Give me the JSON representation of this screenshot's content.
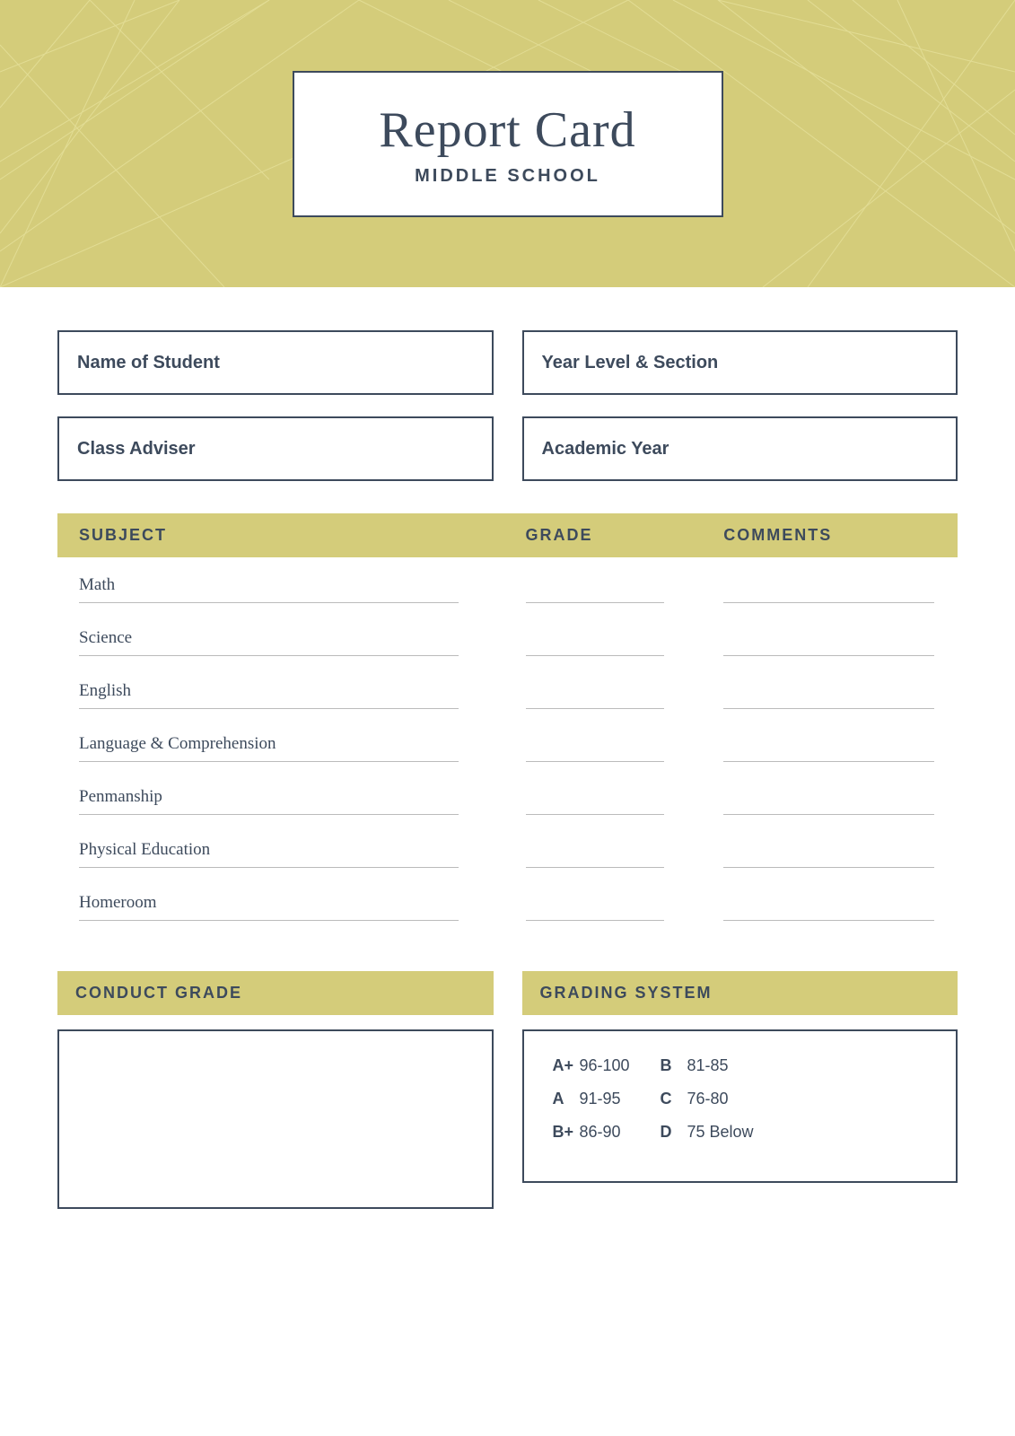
{
  "header": {
    "title": "Report Card",
    "subtitle": "MIDDLE SCHOOL"
  },
  "info": {
    "name_label": "Name of Student",
    "year_label": "Year Level & Section",
    "adviser_label": "Class Adviser",
    "academic_label": "Academic Year"
  },
  "table": {
    "col_subject": "SUBJECT",
    "col_grade": "GRADE",
    "col_comments": "COMMENTS",
    "subjects": [
      {
        "name": "Math"
      },
      {
        "name": "Science"
      },
      {
        "name": "English"
      },
      {
        "name": "Language & Comprehension"
      },
      {
        "name": "Penmanship"
      },
      {
        "name": "Physical Education"
      },
      {
        "name": "Homeroom"
      }
    ]
  },
  "conduct": {
    "header": "CONDUCT GRADE"
  },
  "grading": {
    "header": "GRADING SYSTEM",
    "rows": [
      {
        "letter": "A+",
        "range": "96-100",
        "letter2": "B",
        "range2": "81-85"
      },
      {
        "letter": "A",
        "range": "91-95",
        "letter2": "C",
        "range2": "76-80"
      },
      {
        "letter": "B+",
        "range": "86-90",
        "letter2": "D",
        "range2": "75 Below"
      }
    ]
  }
}
